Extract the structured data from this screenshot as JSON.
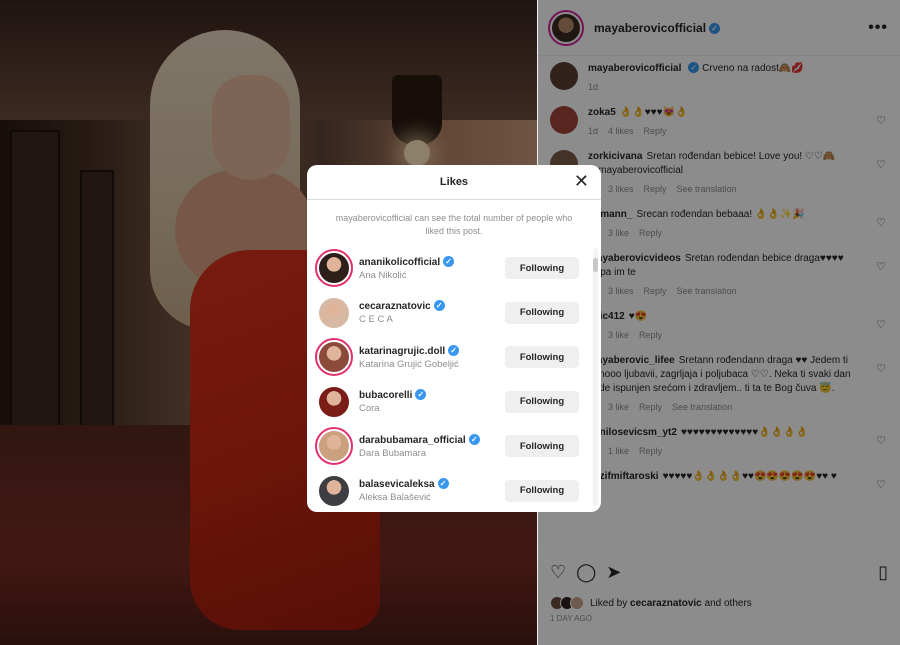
{
  "post": {
    "username": "mayaberovicofficial",
    "more_label": "•••",
    "caption": {
      "user": "mayaberovicofficial",
      "text": "Crveno na radost🙈💋",
      "time": "1d"
    }
  },
  "comments": [
    {
      "user": "zoka5",
      "text": "👌👌♥♥♥😻👌",
      "time": "1d",
      "likes": "4 likes",
      "reply": "Reply",
      "translate": ""
    },
    {
      "user": "zorkicivana",
      "text": "Sretan rođendan bebice! Love you! ♡♡🙈 @mayaberovicofficial",
      "time": "1d",
      "likes": "3 likes",
      "reply": "Reply",
      "translate": "See translation"
    },
    {
      "user": "riemann_",
      "text": "Srecan rođendan bebaaa! 👌👌✨🎉",
      "time": "1d",
      "likes": "3 like",
      "reply": "Reply",
      "translate": ""
    },
    {
      "user": "mayaberovicvideos",
      "text": "Sretan rođendan bebice draga♥♥♥♥ lijepa im te",
      "time": "1d",
      "likes": "3 likes",
      "reply": "Reply",
      "translate": "See translation"
    },
    {
      "user": "ovic412",
      "text": "♥😍",
      "time": "1d",
      "likes": "3 like",
      "reply": "Reply",
      "translate": ""
    },
    {
      "user": "mayaberovic_lifee",
      "text": "Sretann rođendann draga ♥♥ Jedem ti punooo ljubavii, zagrljaja i poljubaca ♡♡. Neka ti svaki dan bude ispunjen srećom i zdravljem.. ti ta te Bog čuva 😇.",
      "time": "1d",
      "likes": "3 like",
      "reply": "Reply",
      "translate": "See translation"
    },
    {
      "user": "danilosevicsm_yt2",
      "text": "♥♥♥♥♥♥♥♥♥♥♥♥♥👌👌👌👌",
      "time": "1d",
      "likes": "1 like",
      "reply": "Reply",
      "translate": ""
    },
    {
      "user": "nazifmiftaroski",
      "text": "♥♥♥♥♥👌👌👌👌♥♥😍😍😍😍😍♥♥ ♥",
      "time": "",
      "likes": "",
      "reply": "",
      "translate": ""
    }
  ],
  "liked_by": {
    "prefix": "Liked by",
    "user": "cecaraznatovic",
    "suffix": "and others"
  },
  "posted_ago": "1 day ago",
  "likes_modal": {
    "title": "Likes",
    "close": "✕",
    "note": "mayaberovicofficial can see the total number of people who liked this post.",
    "button_label": "Following",
    "people": [
      {
        "username": "ananikolicofficial",
        "name": "Ana Nikolić",
        "color": "#2d1f1a",
        "story": true
      },
      {
        "username": "cecaraznatovic",
        "name": "C E C A",
        "color": "#d8b8a2",
        "story": false
      },
      {
        "username": "katarinagrujic.doll",
        "name": "Katarina Grujić Gobeljić",
        "color": "#8c4a3a",
        "story": true
      },
      {
        "username": "bubacorelli",
        "name": "Cora",
        "color": "#7a1d16",
        "story": false
      },
      {
        "username": "darabubamara_official",
        "name": "Dara Bubamara",
        "color": "#caa07e",
        "story": true
      },
      {
        "username": "balasevicaleksa",
        "name": "Aleksa Balašević",
        "color": "#3d3d42",
        "story": false
      }
    ]
  },
  "colors": {
    "verified": "#3897f0",
    "heart": "#ed4956",
    "button_bg": "#efefef"
  },
  "icons": [
    "heart-icon",
    "comment-icon",
    "share-icon",
    "bookmark-icon",
    "close-icon",
    "verified-icon",
    "more-icon"
  ]
}
